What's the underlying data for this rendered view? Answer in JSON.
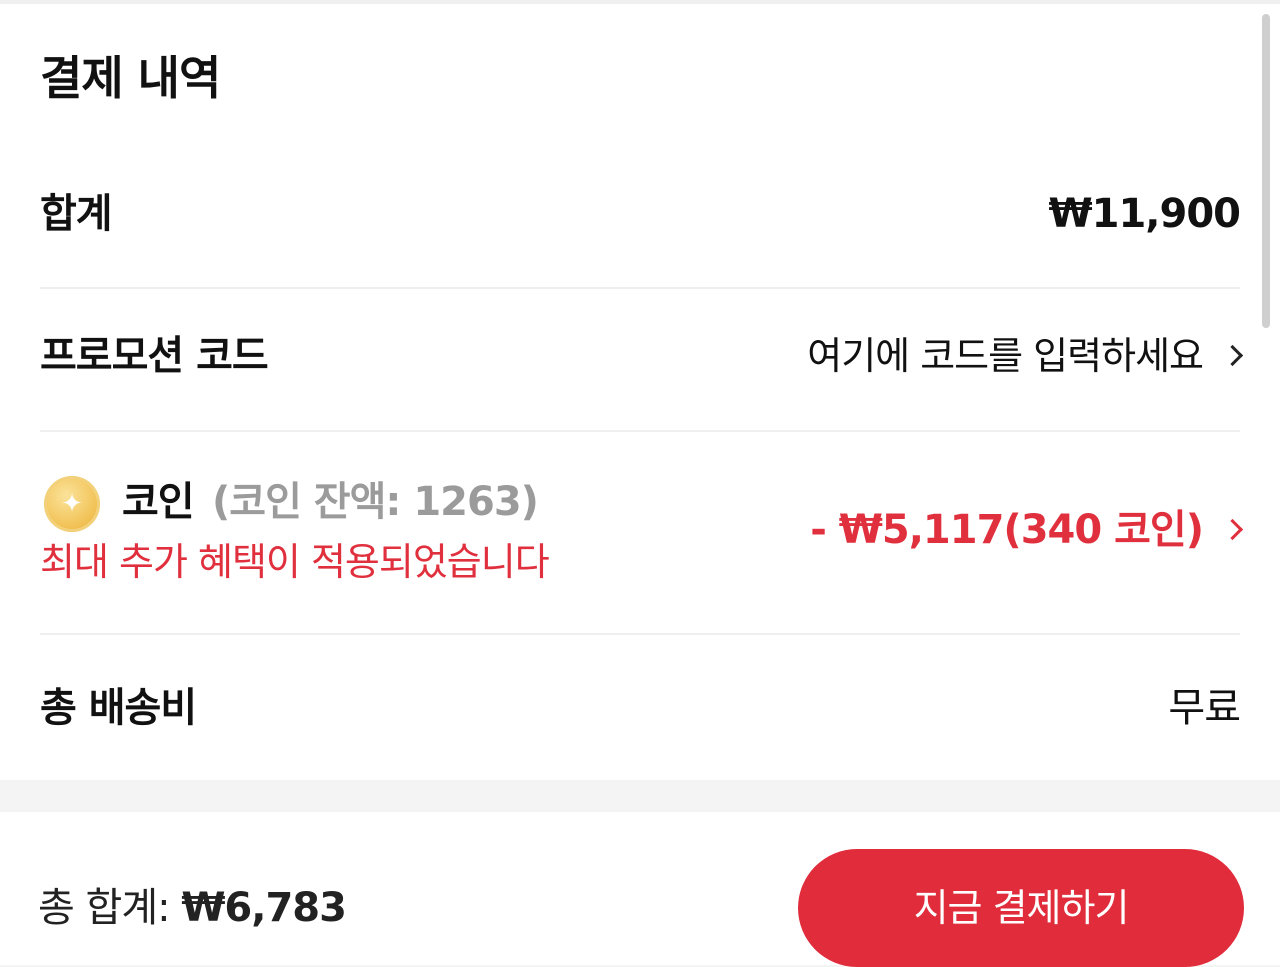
{
  "header": {
    "title": "결제 내역"
  },
  "summary": {
    "subtotal_label": "합계",
    "subtotal_value": "₩11,900",
    "promo_label": "프로모션 코드",
    "promo_placeholder": "여기에 코드를 입력하세요",
    "coin_label": "코인",
    "coin_balance": "(코인 잔액: 1263)",
    "coin_benefit": "최대 추가 혜택이 적용되었습니다",
    "coin_discount": "- ₩5,117(340 코인)",
    "shipping_label": "총 배송비",
    "shipping_value": "무료"
  },
  "footer": {
    "total_label": "총 합계:",
    "total_value": "₩6,783",
    "pay_button": "지금 결제하기"
  },
  "icons": {
    "coin": "coin-icon",
    "promo_chevron": "chevron-right-icon",
    "coin_chevron": "chevron-right-icon"
  },
  "colors": {
    "accent_red": "#e0303d",
    "button_red": "#e02c3b",
    "muted_gray": "#9b9b9b"
  }
}
